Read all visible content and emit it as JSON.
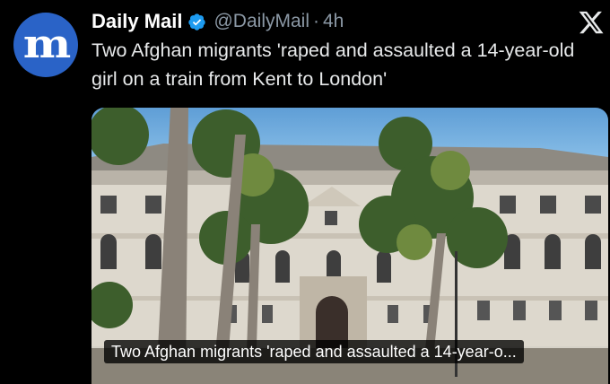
{
  "tweet": {
    "author_name": "Daily Mail",
    "handle": "@DailyMail",
    "separator": "·",
    "time": "4h",
    "avatar_letter": "m",
    "headline": "Two Afghan migrants 'raped and assaulted a 14-year-old girl on a train from Kent to London'",
    "media_caption": "Two Afghan migrants 'raped and assaulted a 14-year-o..."
  },
  "colors": {
    "background": "#000000",
    "avatar_blue": "#2a63c7",
    "verified_blue": "#1d9bf0",
    "muted_text": "#8b98a5"
  },
  "icons": {
    "verified": "verified-badge-icon",
    "close": "x-logo-icon"
  }
}
